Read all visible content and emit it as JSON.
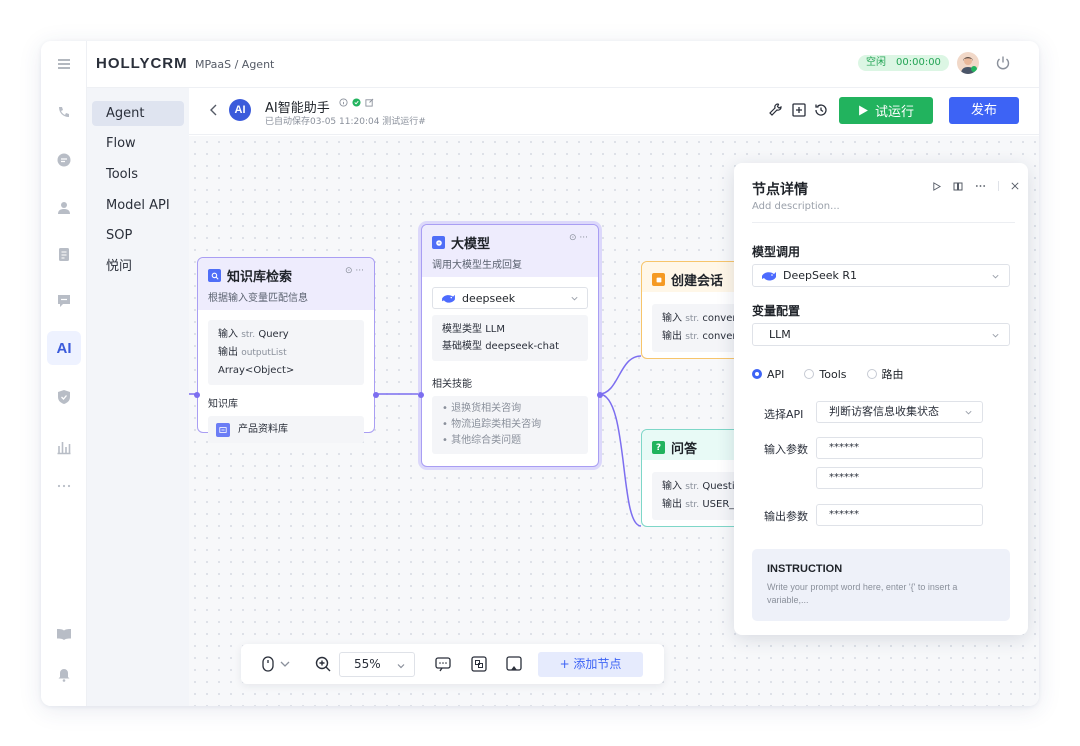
{
  "header": {
    "brand": "HOLLYCRM",
    "breadcrumb": "MPaaS  / Agent",
    "status_label": "空闲",
    "status_timer": "00:00:00"
  },
  "rail": {
    "ai_label": "AI",
    "icons": [
      "menu-icon",
      "phone-icon",
      "chat-icon",
      "user-icon",
      "clipboard-icon",
      "message-icon",
      "ai-icon",
      "shield-icon",
      "chart-icon",
      "more-icon",
      "book-icon",
      "bell-icon"
    ]
  },
  "subnav": {
    "items": [
      {
        "label": "Agent",
        "active": true
      },
      {
        "label": "Flow"
      },
      {
        "label": "Tools"
      },
      {
        "label": "Model API"
      },
      {
        "label": "SOP"
      },
      {
        "label": "悦问"
      }
    ]
  },
  "agent": {
    "logo": "AI",
    "name": "AI智能助手",
    "meta": "已自动保存03-05 11:20:04   测试运行#",
    "run_label": "试运行",
    "publish_label": "发布"
  },
  "nodes": {
    "kb": {
      "title": "知识库检索",
      "subtitle": "根据输入变量匹配信息",
      "in_label": "输入",
      "in_type": "str.",
      "in_name": "Query",
      "out_label": "输出",
      "out_type": "outputList",
      "out_name": "Array<Object>",
      "section": "知识库",
      "kb_item": "产品资料库"
    },
    "llm": {
      "title": "大模型",
      "subtitle": "调用大模型生成回复",
      "model_select": "deepseek",
      "type_label": "模型类型",
      "type_value": "LLM",
      "base_label": "基础模型",
      "base_value": "deepseek-chat",
      "skills_label": "相关技能",
      "skills": [
        "退换货相关咨询",
        "物流追踪类相关咨询",
        "其他综合类问题"
      ]
    },
    "session": {
      "title": "创建会话",
      "in_label": "输入",
      "in_type": "str.",
      "in_name": "convers",
      "out_label": "输出",
      "out_type": "str.",
      "out_name": "convers"
    },
    "qa": {
      "title": "问答",
      "in_label": "输入",
      "in_type": "str.",
      "in_name": "Question",
      "out_label": "输出",
      "out_type": "str.",
      "out_name": "USER_R"
    }
  },
  "toolbar": {
    "zoom": "55%",
    "add_node": "+ 添加节点"
  },
  "panel": {
    "title": "节点详情",
    "description": "Add description...",
    "model_label": "模型调用",
    "model_value": "DeepSeek R1",
    "var_label": "变量配置",
    "var_value": "LLM",
    "radios": [
      {
        "label": "API",
        "checked": true
      },
      {
        "label": "Tools",
        "checked": false
      },
      {
        "label": "路由",
        "checked": false
      }
    ],
    "api_label": "选择API",
    "api_value": "判断访客信息收集状态",
    "input_label": "输入参数",
    "input_value_1": "******",
    "input_value_2": "******",
    "output_label": "输出参数",
    "output_value": "******",
    "instruction_title": "INSTRUCTION",
    "instruction_placeholder": "Write your prompt word here, enter '{' to insert a variable,..."
  },
  "colors": {
    "accent": "#3d63f5",
    "run_green": "#22b35e",
    "edge": "#7c6ef0",
    "session_border": "#f7c56b",
    "qa_border": "#7ed7c8"
  }
}
